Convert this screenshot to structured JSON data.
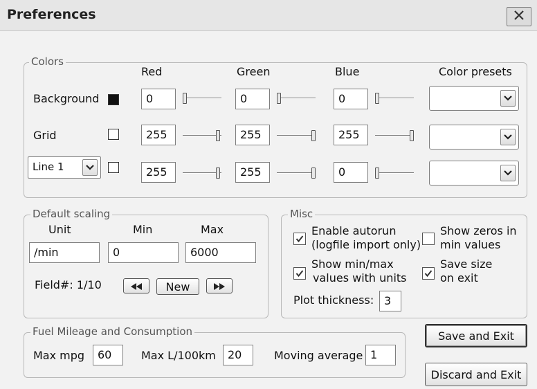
{
  "window": {
    "title": "Preferences"
  },
  "colors": {
    "legend": "Colors",
    "headers": {
      "red": "Red",
      "green": "Green",
      "blue": "Blue",
      "presets": "Color presets"
    },
    "rows": [
      {
        "label": "Background",
        "swatch_color": "#111111",
        "red": "0",
        "green": "0",
        "blue": "0",
        "preset": ""
      },
      {
        "label": "Grid",
        "swatch_color": "#ffffff",
        "red": "255",
        "green": "255",
        "blue": "255",
        "preset": ""
      },
      {
        "label": "Line 1",
        "swatch_color": "#ffffff",
        "red": "255",
        "green": "255",
        "blue": "0",
        "preset": ""
      }
    ]
  },
  "scaling": {
    "legend": "Default scaling",
    "unit_label": "Unit",
    "min_label": "Min",
    "max_label": "Max",
    "unit": "/min",
    "min": "0",
    "max": "6000",
    "field_label": "Field#: 1/10",
    "new_label": "New"
  },
  "misc": {
    "legend": "Misc",
    "autorun_line1": "Enable autorun",
    "autorun_line2": "(logfile import only)",
    "zeros_line1": "Show zeros in",
    "zeros_line2": "min values",
    "minmax_line1": "Show min/max",
    "minmax_line2": "values with units",
    "savesize_line1": "Save size",
    "savesize_line2": "on exit",
    "thickness_label": "Plot thickness:",
    "thickness": "3"
  },
  "fuel": {
    "legend": "Fuel Mileage and Consumption",
    "mpg_label": "Max mpg",
    "mpg": "60",
    "l100_label": "Max L/100km",
    "l100": "20",
    "avg_label": "Moving average",
    "avg": "1"
  },
  "buttons": {
    "save_exit": "Save and Exit",
    "discard_exit": "Discard and Exit"
  }
}
